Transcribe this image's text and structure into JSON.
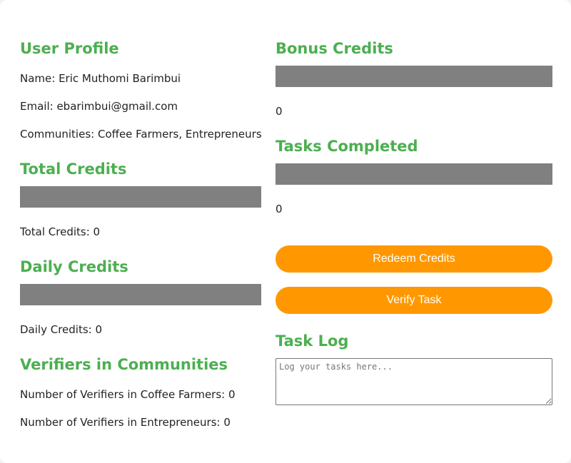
{
  "user_profile": {
    "title": "User Profile",
    "name": "Name: Eric Muthomi Barimbui",
    "email": "Email: ebarimbui@gmail.com",
    "communities": "Communities: Coffee Farmers, Entrepreneurs"
  },
  "total_credits": {
    "title": "Total Credits",
    "progress": 0,
    "label": "Total Credits: 0"
  },
  "daily_credits": {
    "title": "Daily Credits",
    "progress": 0,
    "label": "Daily Credits: 0"
  },
  "verifiers": {
    "title": "Verifiers in Communities",
    "items": [
      "Number of Verifiers in Coffee Farmers: 0",
      "Number of Verifiers in Entrepreneurs: 0"
    ]
  },
  "bonus_credits": {
    "title": "Bonus Credits",
    "progress": 0,
    "value": "0"
  },
  "tasks_completed": {
    "title": "Tasks Completed",
    "progress": 0,
    "value": "0"
  },
  "actions": {
    "redeem_label": "Redeem Credits",
    "verify_label": "Verify Task"
  },
  "task_log": {
    "title": "Task Log",
    "placeholder": "Log your tasks here...",
    "value": ""
  },
  "colors": {
    "heading": "#4caf50",
    "bar_track": "#808080",
    "button": "#ff9800",
    "button_text": "#ffffff"
  }
}
